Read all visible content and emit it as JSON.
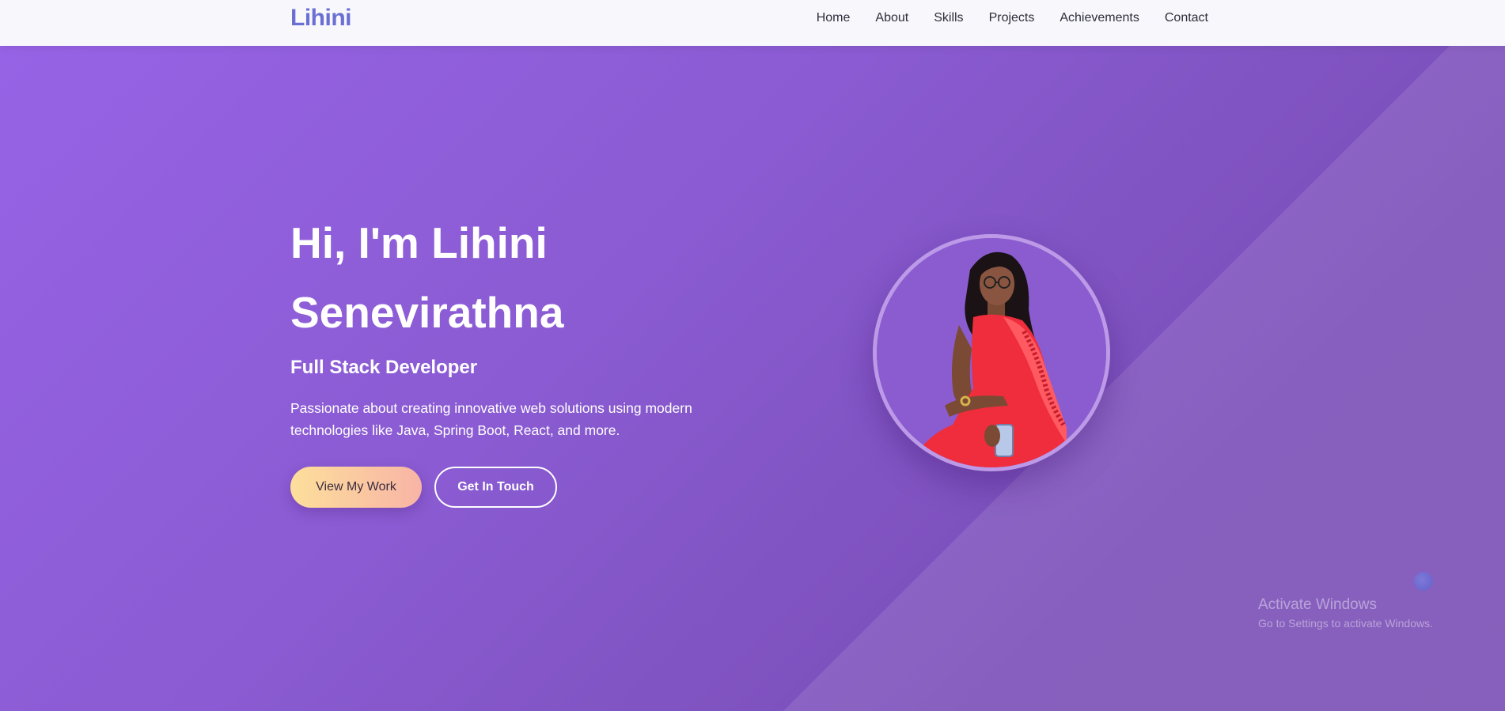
{
  "nav": {
    "logo": "Lihini",
    "links": [
      "Home",
      "About",
      "Skills",
      "Projects",
      "Achievements",
      "Contact"
    ]
  },
  "hero": {
    "title_line1": "Hi, I'm Lihini",
    "title_line2": "Senevirathna",
    "subtitle": "Full Stack Developer",
    "description": "Passionate about creating innovative web solutions using modern technologies like Java, Spring Boot, React, and more.",
    "primary_button": "View My Work",
    "secondary_button": "Get In Touch"
  },
  "watermark": {
    "title": "Activate Windows",
    "subtitle": "Go to Settings to activate Windows."
  },
  "colors": {
    "logo": "#6a6fd2",
    "hero_gradient_start": "#9763e6",
    "hero_gradient_end": "#7a4db5",
    "primary_button_start": "#fddf9b",
    "primary_button_end": "#f8b4a6"
  }
}
